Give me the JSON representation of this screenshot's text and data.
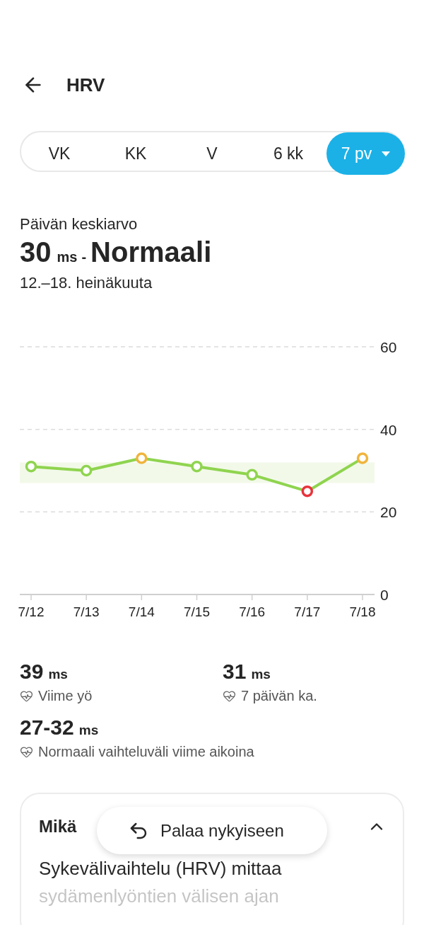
{
  "header": {
    "title": "HRV"
  },
  "range_tabs": [
    {
      "label": "VK",
      "selected": false
    },
    {
      "label": "KK",
      "selected": false
    },
    {
      "label": "V",
      "selected": false
    },
    {
      "label": "6 kk",
      "selected": false
    },
    {
      "label": "7 pv",
      "selected": true
    }
  ],
  "summary": {
    "caption": "Päivän keskiarvo",
    "value": "30",
    "unit": "ms",
    "separator": "-",
    "status": "Normaali",
    "date_range": "12.–18. heinäkuuta"
  },
  "chart": {
    "chart_data": {
      "type": "line",
      "categories": [
        "7/12",
        "7/13",
        "7/14",
        "7/15",
        "7/16",
        "7/17",
        "7/18"
      ],
      "series": [
        {
          "color": "#8fd44f",
          "marker": "o",
          "values": [
            31,
            30,
            33,
            31,
            29,
            25,
            33
          ]
        }
      ],
      "ylim": [
        0,
        60
      ],
      "yticks": [
        0,
        20,
        40,
        60
      ],
      "bands": [
        {
          "axis": "y",
          "from": 27,
          "to": 32
        }
      ]
    }
  },
  "stats": [
    {
      "value": "39",
      "unit": "ms",
      "label": "Viime yö"
    },
    {
      "value": "31",
      "unit": "ms",
      "label": "7 päivän ka."
    },
    {
      "value": "27-32",
      "unit": "ms",
      "label": "Normaali vaihteluväli viime aikoina"
    }
  ],
  "info_card": {
    "title": "Mikä",
    "expanded": true,
    "body": "Sykevälivaihtelu (HRV) mittaa sydämenlyöntien välisen ajan"
  },
  "floating_button": {
    "label": "Palaa nykyiseen"
  }
}
